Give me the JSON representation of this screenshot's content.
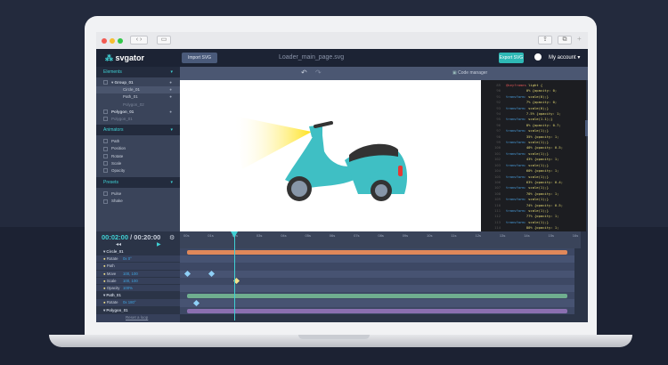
{
  "app": {
    "logo": "svgator",
    "import_label": "Import SVG",
    "file_name": "Loader_main_page.svg",
    "export_label": "Export SVG",
    "account_label": "My account",
    "code_manager": "Code manager"
  },
  "sidebar": {
    "elements_title": "Elements",
    "elements": [
      "Group_01",
      "Circle_01",
      "Path_01",
      "Polygon_01",
      "Polygon_01",
      "Polygon_02"
    ],
    "animators_title": "Animators",
    "animators": [
      "Path",
      "Position",
      "Rotate",
      "Scale",
      "Opacity"
    ],
    "presets_title": "Presets",
    "presets": [
      "Pulse",
      "Shake"
    ]
  },
  "code": [
    {
      "n": "89",
      "a": "@keyframes",
      "b": " light {"
    },
    {
      "n": "90",
      "a": "",
      "b": "          0% {opacity: 0;"
    },
    {
      "n": "91",
      "a": "transform:",
      "b": " scale(0);}"
    },
    {
      "n": "92",
      "a": "",
      "b": "          7% {opacity: 0;"
    },
    {
      "n": "93",
      "a": "transform:",
      "b": " scale(0);}"
    },
    {
      "n": "94",
      "a": "",
      "b": "          7.5% {opacity: 1;"
    },
    {
      "n": "95",
      "a": "transform:",
      "b": " scale(1.1);}"
    },
    {
      "n": "96",
      "a": "",
      "b": "          8% {opacity: 0.7;"
    },
    {
      "n": "97",
      "a": "transform:",
      "b": " scale(1);}"
    },
    {
      "n": "98",
      "a": "",
      "b": "          35% {opacity: 1;"
    },
    {
      "n": "99",
      "a": "transform:",
      "b": " scale(1);}"
    },
    {
      "n": "100",
      "a": "",
      "b": "          40% {opacity: 0.5;"
    },
    {
      "n": "101",
      "a": "transform:",
      "b": " scale(1);}"
    },
    {
      "n": "102",
      "a": "",
      "b": "          43% {opacity: 1;"
    },
    {
      "n": "103",
      "a": "transform:",
      "b": " scale(1);}"
    },
    {
      "n": "104",
      "a": "",
      "b": "          60% {opacity: 1;"
    },
    {
      "n": "105",
      "a": "transform:",
      "b": " scale(1);}"
    },
    {
      "n": "106",
      "a": "",
      "b": "          63% {opacity: 0.4;"
    },
    {
      "n": "107",
      "a": "transform:",
      "b": " scale(1);}"
    },
    {
      "n": "108",
      "a": "",
      "b": "          70% {opacity: 1;"
    },
    {
      "n": "109",
      "a": "transform:",
      "b": " scale(1);}"
    },
    {
      "n": "110",
      "a": "",
      "b": "          74% {opacity: 0.5;"
    },
    {
      "n": "111",
      "a": "transform:",
      "b": " scale(1);}"
    },
    {
      "n": "112",
      "a": "",
      "b": "          77% {opacity: 1;"
    },
    {
      "n": "113",
      "a": "transform:",
      "b": " scale(1);}"
    },
    {
      "n": "114",
      "a": "",
      "b": "          80% {opacity: 1;"
    },
    {
      "n": "115",
      "a": "transform:",
      "b": " scale(1);}"
    },
    {
      "n": "116",
      "a": "",
      "b": "          83% {opacity: 0.5;"
    },
    {
      "n": "117",
      "a": "transform:",
      "b": " scale(1);}"
    }
  ],
  "timeline": {
    "current": "00:02:00",
    "total": "/ 00:20:00",
    "ticks": [
      "00s",
      "01s",
      "02s",
      "03s",
      "04s",
      "05s",
      "06s",
      "07s",
      "08s",
      "09s",
      "10s",
      "11s",
      "12s",
      "13s",
      "14s",
      "15s",
      "16s"
    ],
    "rows": [
      {
        "label": "Circle_01",
        "value": "",
        "bar": "#e0885a"
      },
      {
        "label": "Rotate",
        "value": "0x 0°"
      },
      {
        "label": "Path",
        "value": ""
      },
      {
        "label": "Move",
        "value": "100, 100",
        "kf": [
          0,
          1
        ]
      },
      {
        "label": "Scale",
        "value": "100, 100",
        "kfy": [
          2
        ]
      },
      {
        "label": "Opacity",
        "value": "100%"
      },
      {
        "label": "Path_01",
        "value": "",
        "bar": "#6fae8f"
      },
      {
        "label": "Rotate",
        "value": "0x 180°",
        "kf": [
          0.35
        ]
      },
      {
        "label": "Polygon_01",
        "value": "",
        "bar": "#8b6fb0"
      }
    ],
    "reset": "Reset a loop"
  }
}
